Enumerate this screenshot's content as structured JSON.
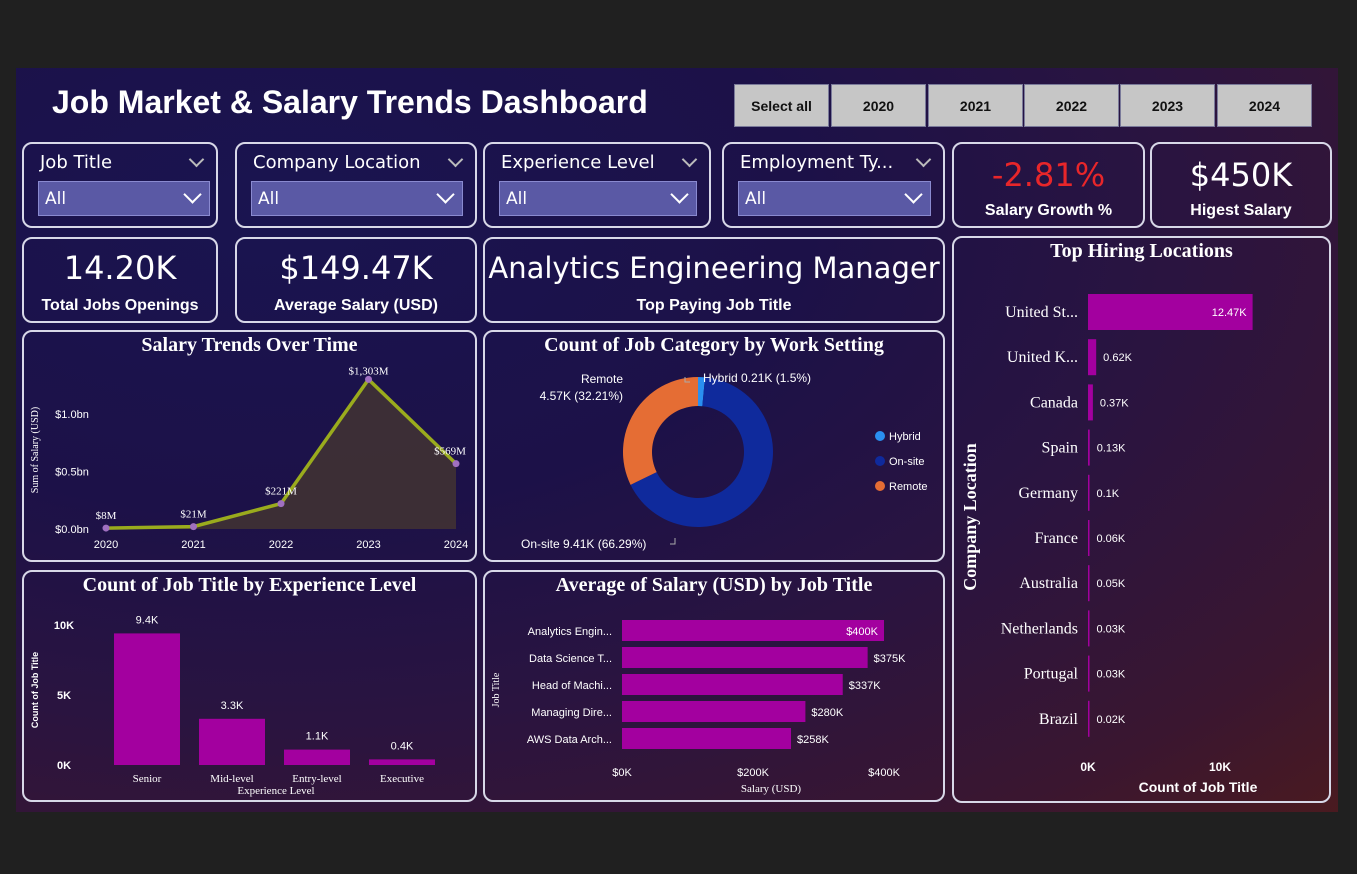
{
  "title": "Job Market & Salary Trends Dashboard",
  "year_buttons": [
    "Select all",
    "2020",
    "2021",
    "2022",
    "2023",
    "2024"
  ],
  "slicers": [
    {
      "label": "Job Title",
      "value": "All"
    },
    {
      "label": "Company Location",
      "value": "All"
    },
    {
      "label": "Experience Level",
      "value": "All"
    },
    {
      "label": "Employment Ty...",
      "value": "All"
    }
  ],
  "kpis": {
    "salary_growth": {
      "value": "-2.81%",
      "label": "Salary Growth %",
      "color": "#e8262a"
    },
    "highest_salary": {
      "value": "$450K",
      "label": "Higest Salary"
    },
    "total_jobs": {
      "value": "14.20K",
      "label": "Total Jobs Openings"
    },
    "avg_salary": {
      "value": "$149.47K",
      "label": "Average Salary (USD)"
    },
    "top_job": {
      "value": "Analytics Engineering Manager",
      "label": "Top Paying Job Title"
    }
  },
  "colors": {
    "magenta": "#a3009f",
    "line": "#9aab1d",
    "onsite": "#0f2a9c",
    "remote": "#e56d34",
    "hybrid": "#2a8ff0"
  },
  "chart_data": [
    {
      "id": "salary_trend",
      "type": "area",
      "title": "Salary Trends Over Time",
      "ylabel": "Sum of Salary (USD)",
      "x": [
        "2020",
        "2021",
        "2022",
        "2023",
        "2024"
      ],
      "values": [
        8,
        21,
        221,
        1303,
        569
      ],
      "labels": [
        "$8M",
        "$21M",
        "$221M",
        "$1,303M",
        "$569M"
      ],
      "y_ticks": [
        "$0.0bn",
        "$0.5bn",
        "$1.0bn"
      ],
      "ylim": [
        0,
        1350
      ]
    },
    {
      "id": "work_setting",
      "type": "pie",
      "title": "Count of Job Category by Work Setting",
      "slices": [
        {
          "name": "Hybrid",
          "value": 1.5,
          "label": "Hybrid 0.21K (1.5%)"
        },
        {
          "name": "On-site",
          "value": 66.29,
          "label": "On-site 9.41K (66.29%)"
        },
        {
          "name": "Remote",
          "value": 32.21,
          "label_line1": "Remote",
          "label_line2": "4.57K (32.21%)"
        }
      ],
      "legend": [
        "Hybrid",
        "On-site",
        "Remote"
      ]
    },
    {
      "id": "experience",
      "type": "bar",
      "title": "Count of Job Title by Experience Level",
      "xlabel": "Experience Level",
      "ylabel": "Count of Job Title",
      "categories": [
        "Senior",
        "Mid-level",
        "Entry-level",
        "Executive"
      ],
      "values": [
        9.4,
        3.3,
        1.1,
        0.4
      ],
      "labels": [
        "9.4K",
        "3.3K",
        "1.1K",
        "0.4K"
      ],
      "y_ticks": [
        "0K",
        "5K",
        "10K"
      ],
      "ylim": [
        0,
        10
      ]
    },
    {
      "id": "avg_salary_title",
      "type": "bar",
      "title": "Average of Salary (USD) by Job Title",
      "xlabel": "Salary (USD)",
      "ylabel": "Job Title",
      "categories": [
        "Analytics Engin...",
        "Data Science T...",
        "Head of Machi...",
        "Managing Dire...",
        "AWS Data Arch..."
      ],
      "values": [
        400,
        375,
        337,
        280,
        258
      ],
      "labels": [
        "$400K",
        "$375K",
        "$337K",
        "$280K",
        "$258K"
      ],
      "x_ticks": [
        "$0K",
        "$200K",
        "$400K"
      ],
      "xlim": [
        0,
        400
      ]
    },
    {
      "id": "locations",
      "type": "bar",
      "title": "Top Hiring Locations",
      "xlabel": "Count of Job Title",
      "ylabel": "Company Location",
      "categories": [
        "United St...",
        "United K...",
        "Canada",
        "Spain",
        "Germany",
        "France",
        "Australia",
        "Netherlands",
        "Portugal",
        "Brazil"
      ],
      "values": [
        12.47,
        0.62,
        0.37,
        0.13,
        0.1,
        0.06,
        0.05,
        0.03,
        0.03,
        0.02
      ],
      "labels": [
        "12.47K",
        "0.62K",
        "0.37K",
        "0.13K",
        "0.1K",
        "0.06K",
        "0.05K",
        "0.03K",
        "0.03K",
        "0.02K"
      ],
      "x_ticks": [
        "0K",
        "10K"
      ],
      "xlim": [
        0,
        10
      ]
    }
  ]
}
